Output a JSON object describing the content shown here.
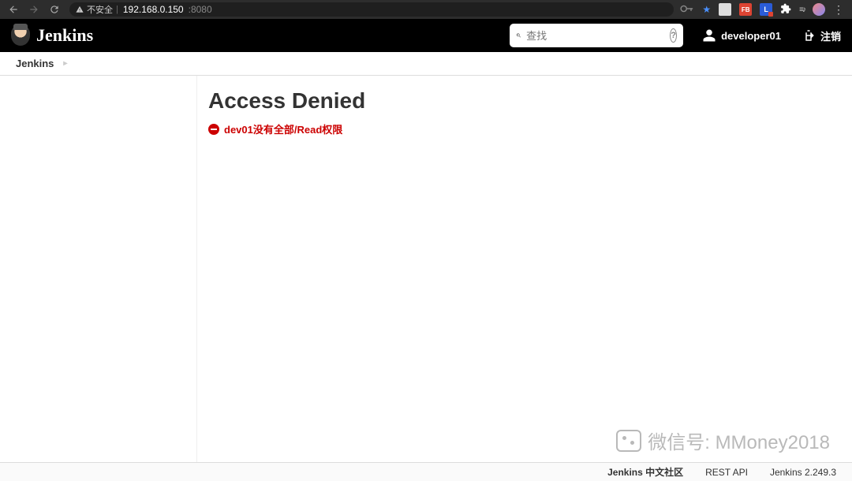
{
  "browser": {
    "insecure_label": "不安全",
    "url_host": "192.168.0.150",
    "url_port": ":8080"
  },
  "header": {
    "brand": "Jenkins",
    "search_placeholder": "查找",
    "username": "developer01",
    "logout_label": "注销"
  },
  "breadcrumb": {
    "root": "Jenkins"
  },
  "main": {
    "title": "Access Denied",
    "error": "dev01没有全部/Read权限"
  },
  "footer": {
    "community": "Jenkins 中文社区",
    "rest_api": "REST API",
    "version": "Jenkins 2.249.3"
  },
  "watermark": {
    "text": "微信号: MMoney2018"
  }
}
